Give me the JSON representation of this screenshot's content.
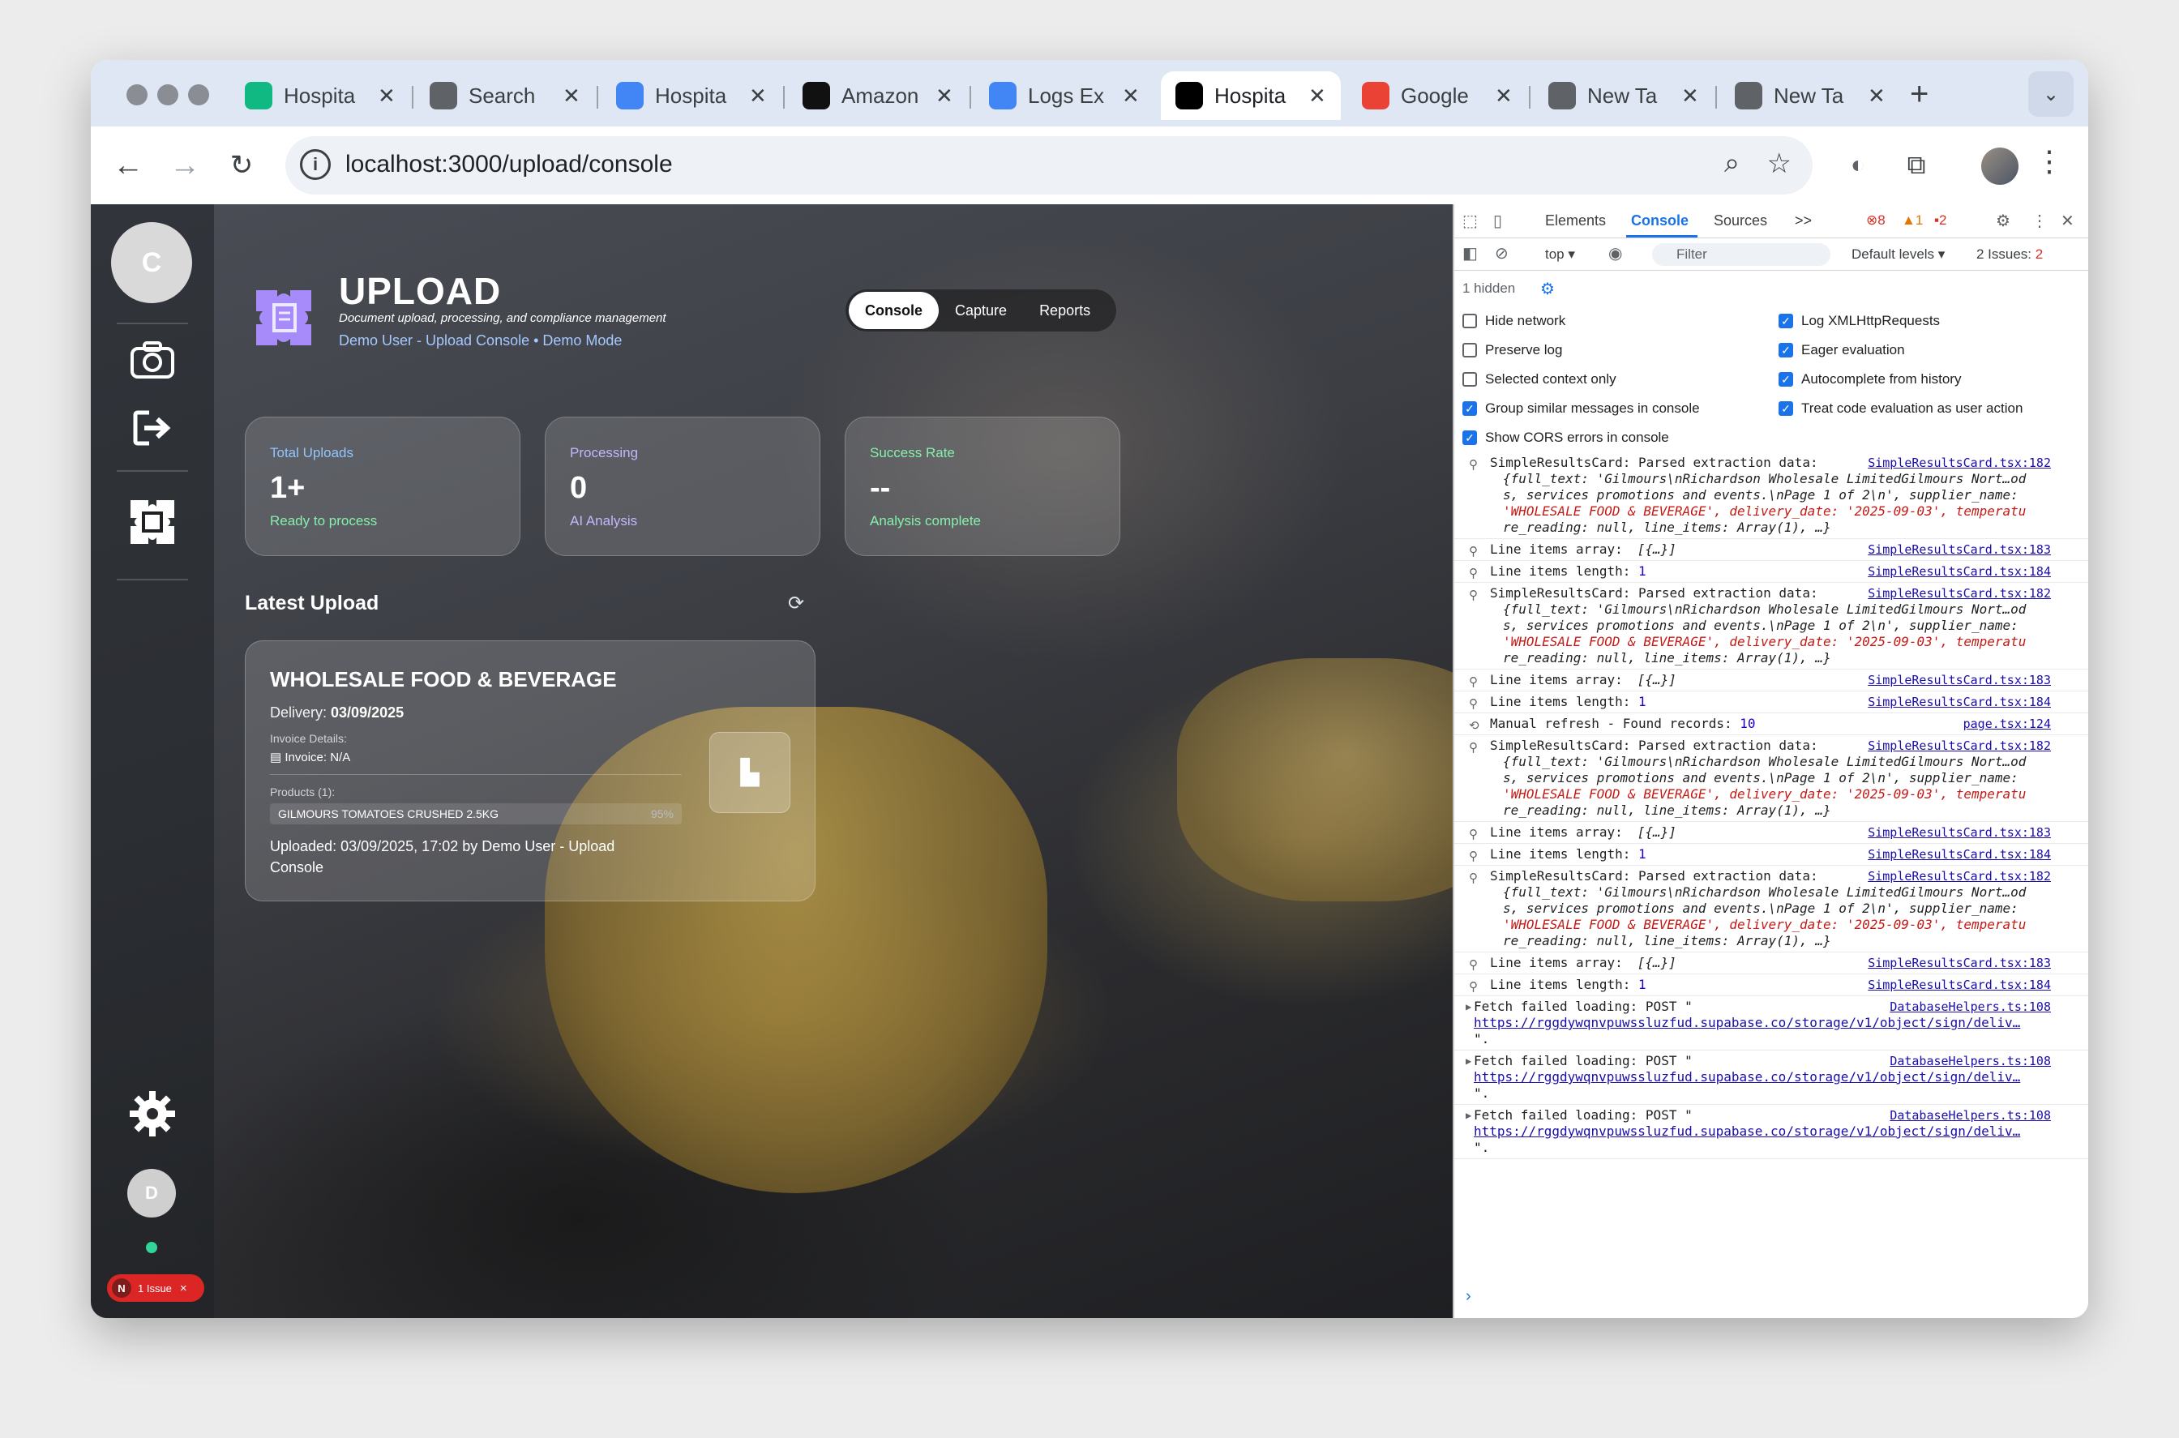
{
  "browser": {
    "tabs": [
      {
        "label": "Hospita",
        "icon": "bolt-icon",
        "color": "#10b981"
      },
      {
        "label": "Search",
        "icon": "chrome-icon",
        "color": "#5f6368"
      },
      {
        "label": "Hospita",
        "icon": "doc-icon",
        "color": "#4285f4"
      },
      {
        "label": "Amazon",
        "icon": "amazon-icon",
        "color": "#111111"
      },
      {
        "label": "Logs Ex",
        "icon": "list-icon",
        "color": "#4285f4"
      },
      {
        "label": "Hospita",
        "icon": "vercel-icon",
        "color": "#000000",
        "active": true
      },
      {
        "label": "Google",
        "icon": "google-icon",
        "color": "#ea4335"
      },
      {
        "label": "New Ta",
        "icon": "chrome-icon",
        "color": "#5f6368"
      },
      {
        "label": "New Ta",
        "icon": "chrome-icon",
        "color": "#5f6368"
      }
    ],
    "url": "localhost:3000/upload/console"
  },
  "app": {
    "sidebar_avatar": "C",
    "user_initial": "D",
    "issue_badge": {
      "n": "N",
      "label": "1 Issue",
      "close": "×"
    },
    "title": "UPLOAD",
    "subtitle": "Document upload, processing, and compliance management",
    "user_line": "Demo User - Upload Console • Demo Mode",
    "segments": [
      "Console",
      "Capture",
      "Reports"
    ],
    "stats": [
      {
        "label": "Total Uploads",
        "value": "1+",
        "sub": "Ready to process",
        "color": "#93c5fd",
        "sub_color": "#86efac"
      },
      {
        "label": "Processing",
        "value": "0",
        "sub": "AI Analysis",
        "color": "#c4b5fd",
        "sub_color": "#c4b5fd"
      },
      {
        "label": "Success Rate",
        "value": "--",
        "sub": "Analysis complete",
        "color": "#86efac",
        "sub_color": "#86efac"
      }
    ],
    "latest_title": "Latest Upload",
    "card": {
      "supplier": "WHOLESALE FOOD & BEVERAGE",
      "delivery_label": "Delivery:",
      "delivery_value": "03/09/2025",
      "invoice_label": "Invoice Details:",
      "invoice_value": "Invoice: N/A",
      "products_label": "Products (1):",
      "product_name": "GILMOURS TOMATOES CRUSHED 2.5KG",
      "product_pct": "95%",
      "uploaded_label": "Uploaded:",
      "uploaded_value": "03/09/2025, 17:02 by Demo User - Upload Console"
    }
  },
  "devtools": {
    "tabs": [
      "Elements",
      "Console",
      "Sources"
    ],
    "more": ">>",
    "errors": "8",
    "warnings": "1",
    "issues_count": "2",
    "context": "top ▾",
    "filter_placeholder": "Filter",
    "levels": "Default levels ▾",
    "issues_label": "2 Issues:",
    "issues_n": "2",
    "hidden": "1 hidden",
    "options_left": [
      {
        "label": "Hide network",
        "checked": false
      },
      {
        "label": "Preserve log",
        "checked": false
      },
      {
        "label": "Selected context only",
        "checked": false
      },
      {
        "label": "Group similar messages in console",
        "checked": true
      },
      {
        "label": "Show CORS errors in console",
        "checked": true
      }
    ],
    "options_right": [
      {
        "label": "Log XMLHttpRequests",
        "checked": true
      },
      {
        "label": "Eager evaluation",
        "checked": true
      },
      {
        "label": "Autocomplete from history",
        "checked": true
      },
      {
        "label": "Treat code evaluation as user action",
        "checked": true
      }
    ],
    "logs": [
      {
        "kind": "parsed",
        "text": "SimpleResultsCard: Parsed extraction data:",
        "src": "SimpleResultsCard.tsx:182"
      },
      {
        "kind": "array",
        "text": "Line items array:",
        "obj": "[{…}]",
        "src": "SimpleResultsCard.tsx:183"
      },
      {
        "kind": "length",
        "text": "Line items length:",
        "num": "1",
        "src": "SimpleResultsCard.tsx:184"
      },
      {
        "kind": "parsed",
        "text": "SimpleResultsCard: Parsed extraction data:",
        "src": "SimpleResultsCard.tsx:182"
      },
      {
        "kind": "array",
        "text": "Line items array:",
        "obj": "[{…}]",
        "src": "SimpleResultsCard.tsx:183"
      },
      {
        "kind": "length",
        "text": "Line items length:",
        "num": "1",
        "src": "SimpleResultsCard.tsx:184"
      },
      {
        "kind": "refresh",
        "text": "Manual refresh - Found records:",
        "num": "10",
        "src": "page.tsx:124"
      },
      {
        "kind": "parsed",
        "text": "SimpleResultsCard: Parsed extraction data:",
        "src": "SimpleResultsCard.tsx:182"
      },
      {
        "kind": "array",
        "text": "Line items array:",
        "obj": "[{…}]",
        "src": "SimpleResultsCard.tsx:183"
      },
      {
        "kind": "length",
        "text": "Line items length:",
        "num": "1",
        "src": "SimpleResultsCard.tsx:184"
      },
      {
        "kind": "parsed",
        "text": "SimpleResultsCard: Parsed extraction data:",
        "src": "SimpleResultsCard.tsx:182"
      },
      {
        "kind": "array",
        "text": "Line items array:",
        "obj": "[{…}]",
        "src": "SimpleResultsCard.tsx:183"
      },
      {
        "kind": "length",
        "text": "Line items length:",
        "num": "1",
        "src": "SimpleResultsCard.tsx:184"
      },
      {
        "kind": "fetch",
        "text": "Fetch failed loading: POST \"",
        "link": "https://rggdywqnvpuwssluzfud.supabase.co/storage/v1/object/sign/deliv…",
        "end": "\".",
        "src": "DatabaseHelpers.ts:108"
      },
      {
        "kind": "fetch",
        "text": "Fetch failed loading: POST \"",
        "link": "https://rggdywqnvpuwssluzfud.supabase.co/storage/v1/object/sign/deliv…",
        "end": "\".",
        "src": "DatabaseHelpers.ts:108"
      },
      {
        "kind": "fetch",
        "text": "Fetch failed loading: POST \"",
        "link": "https://rggdywqnvpuwssluzfud.supabase.co/storage/v1/object/sign/deliv…",
        "end": "\".",
        "src": "DatabaseHelpers.ts:108"
      }
    ],
    "obj_lines": {
      "line1": "{full_text: 'Gilmours\\nRichardson Wholesale LimitedGilmours Nort…od",
      "line2": "s, services promotions and events.\\nPage 1 of 2\\n', supplier_name:",
      "line3": "'WHOLESALE FOOD & BEVERAGE', delivery_date: '2025-09-03', temperatu",
      "line4": "re_reading: null, line_items: Array(1), …}"
    },
    "prompt": "›"
  }
}
